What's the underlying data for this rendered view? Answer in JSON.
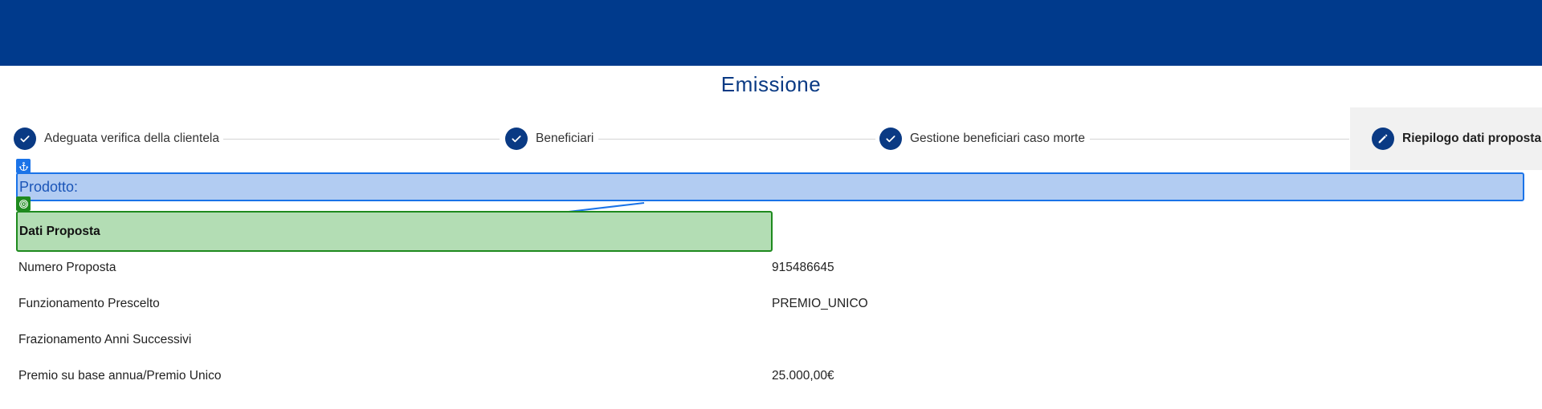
{
  "header": {
    "brand_color": "#003a8c"
  },
  "page": {
    "title": "Emissione"
  },
  "stepper": {
    "steps": [
      {
        "label": "Adeguata verifica della clientela",
        "status": "completed",
        "icon": "check-icon"
      },
      {
        "label": "Beneficiari",
        "status": "completed",
        "icon": "check-icon"
      },
      {
        "label": "Gestione beneficiari caso morte",
        "status": "completed",
        "icon": "check-icon"
      },
      {
        "label": "Riepilogo dati proposta",
        "status": "active",
        "icon": "pencil-icon"
      }
    ]
  },
  "highlight": {
    "anchor_icon": "anchor-icon",
    "target_icon": "target-icon",
    "anchor_color": "#1a73e8",
    "target_color": "#1e8a1e"
  },
  "summary": {
    "product_label": "Prodotto:",
    "section_title": "Dati Proposta",
    "rows": [
      {
        "label": "Numero Proposta",
        "value": "915486645"
      },
      {
        "label": "Funzionamento Prescelto",
        "value": "PREMIO_UNICO"
      },
      {
        "label": "Frazionamento Anni Successivi",
        "value": ""
      },
      {
        "label": "Premio su base annua/Premio Unico",
        "value": "25.000,00€"
      }
    ]
  }
}
